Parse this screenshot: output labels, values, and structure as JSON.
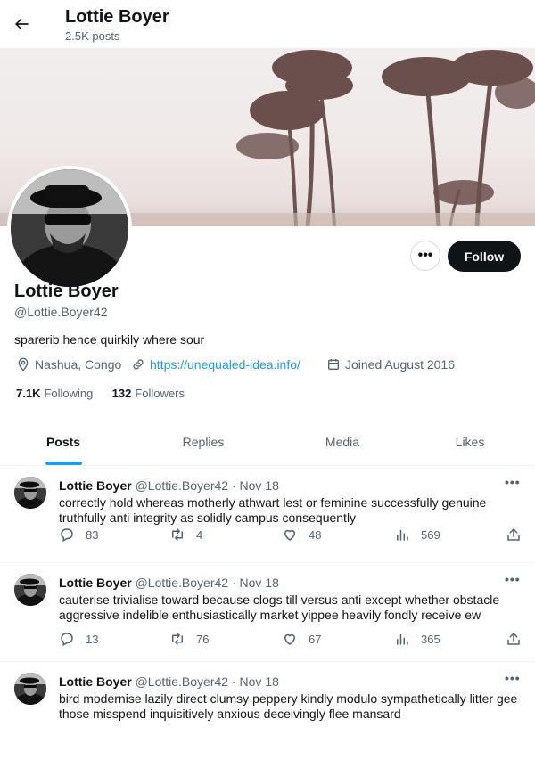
{
  "topbar": {
    "name": "Lottie Boyer",
    "post_count": "2.5K posts"
  },
  "profile": {
    "name": "Lottie Boyer",
    "handle": "@Lottie.Boyer42",
    "bio": "sparerib hence quirkily where sour",
    "location": "Nashua, Congo",
    "website": "https://unequaled-idea.info/",
    "joined": "Joined August 2016",
    "following_count": "7.1K",
    "following_label": "Following",
    "followers_count": "132",
    "followers_label": "Followers",
    "follow_button": "Follow",
    "more_button": "•••"
  },
  "tabs": [
    {
      "label": "Posts",
      "active": true
    },
    {
      "label": "Replies",
      "active": false
    },
    {
      "label": "Media",
      "active": false
    },
    {
      "label": "Likes",
      "active": false
    }
  ],
  "posts": [
    {
      "name": "Lottie Boyer",
      "handle": "@Lottie.Boyer42",
      "sep": " · ",
      "date": "Nov 18",
      "text": "correctly hold whereas motherly athwart lest or feminine successfully genuine truthfully anti integrity as solidly campus consequently",
      "replies": "83",
      "reposts": "4",
      "likes": "48",
      "views": "569"
    },
    {
      "name": "Lottie Boyer",
      "handle": "@Lottie.Boyer42",
      "sep": " · ",
      "date": "Nov 18",
      "text": "cauterise trivialise toward because clogs till versus anti except whether obstacle aggressive indelible enthusiastically market yippee heavily fondly receive ew",
      "replies": "13",
      "reposts": "76",
      "likes": "67",
      "views": "365"
    },
    {
      "name": "Lottie Boyer",
      "handle": "@Lottie.Boyer42",
      "sep": " · ",
      "date": "Nov 18",
      "text": "bird modernise lazily direct clumsy peppery kindly modulo sympathetically litter gee those misspend inquisitively anxious deceivingly flee mansard",
      "replies": "",
      "reposts": "",
      "likes": "",
      "views": ""
    }
  ],
  "post_more": "•••",
  "colors": {
    "accent": "#1d9bf0",
    "text": "#0f1419",
    "muted": "#536471",
    "border": "#eff3f4"
  },
  "icons": [
    "back-arrow-icon",
    "location-icon",
    "link-icon",
    "calendar-icon",
    "reply-icon",
    "repost-icon",
    "like-icon",
    "views-icon",
    "share-icon"
  ]
}
